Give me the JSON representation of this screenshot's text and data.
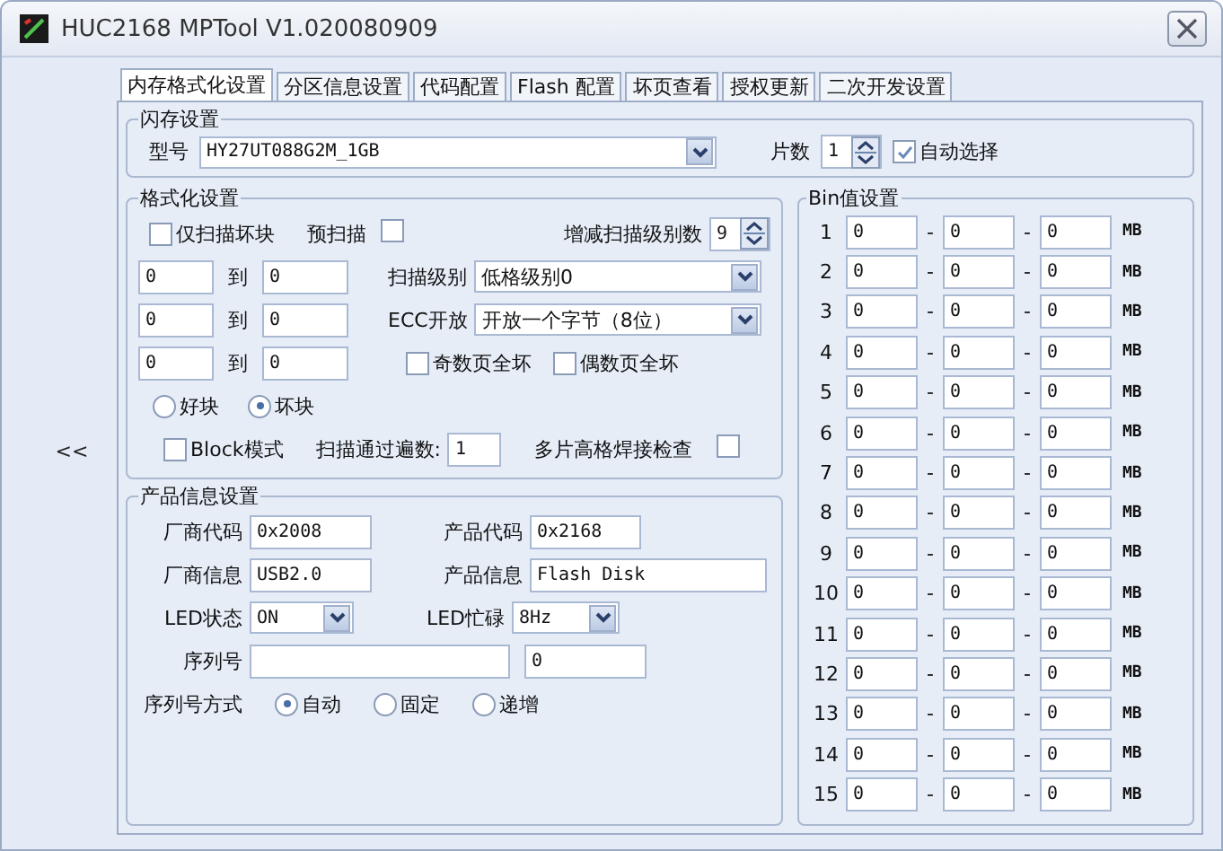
{
  "window": {
    "title": "HUC2168 MPTool V1.020080909"
  },
  "collapse_button": "<<",
  "tabs": [
    {
      "label": "内存格式化设置",
      "selected": true
    },
    {
      "label": "分区信息设置",
      "selected": false
    },
    {
      "label": "代码配置",
      "selected": false
    },
    {
      "label": "Flash 配置",
      "selected": false
    },
    {
      "label": "坏页查看",
      "selected": false
    },
    {
      "label": "授权更新",
      "selected": false
    },
    {
      "label": "二次开发设置",
      "selected": false
    }
  ],
  "flash_group": {
    "title": "闪存设置",
    "model_label": "型号",
    "model_value": "HY27UT088G2M_1GB",
    "chips_label": "片数",
    "chips_value": "1",
    "auto_select": {
      "label": "自动选择",
      "checked": true
    }
  },
  "format_group": {
    "title": "格式化设置",
    "scan_bad_only": {
      "label": "仅扫描坏块",
      "checked": false
    },
    "prescan": {
      "label": "预扫描",
      "checked": false
    },
    "scan_step_label": "增减扫描级别数",
    "scan_step_value": "9",
    "ranges": [
      {
        "from": "0",
        "to_label": "到",
        "to": "0"
      },
      {
        "from": "0",
        "to_label": "到",
        "to": "0"
      },
      {
        "from": "0",
        "to_label": "到",
        "to": "0"
      }
    ],
    "scan_level_label": "扫描级别",
    "scan_level_value": "低格级别0",
    "ecc_label": "ECC开放",
    "ecc_value": "开放一个字节（8位）",
    "odd_pages": {
      "label": "奇数页全坏",
      "checked": false
    },
    "even_pages": {
      "label": "偶数页全坏",
      "checked": false
    },
    "block_type": [
      {
        "label": "好块",
        "selected": false
      },
      {
        "label": "坏块",
        "selected": true
      }
    ],
    "block_mode": {
      "label": "Block模式",
      "checked": false
    },
    "passes_label": "扫描通过遍数:",
    "passes_value": "1",
    "multi_check": {
      "label": "多片高格焊接检查",
      "checked": false
    }
  },
  "product_group": {
    "title": "产品信息设置",
    "vendor_code_label": "厂商代码",
    "vendor_code": "0x2008",
    "product_code_label": "产品代码",
    "product_code": "0x2168",
    "vendor_info_label": "厂商信息",
    "vendor_info": "USB2.0",
    "product_info_label": "产品信息",
    "product_info": "Flash Disk",
    "led_state_label": "LED状态",
    "led_state": "ON",
    "led_busy_label": "LED忙碌",
    "led_busy": "8Hz",
    "serial_label": "序列号",
    "serial_start": "0",
    "serial_mode_label": "序列号方式",
    "serial_modes": [
      {
        "label": "自动",
        "selected": true
      },
      {
        "label": "固定",
        "selected": false
      },
      {
        "label": "递增",
        "selected": false
      }
    ]
  },
  "bin_group": {
    "title": "Bin值设置",
    "rows": [
      {
        "index": "1",
        "value_1": "0",
        "dash_1": "-",
        "value_2": "0",
        "dash_2": "-",
        "value_3": "0",
        "unit": "MB"
      },
      {
        "index": "2",
        "value_1": "0",
        "dash_1": "-",
        "value_2": "0",
        "dash_2": "-",
        "value_3": "0",
        "unit": "MB"
      },
      {
        "index": "3",
        "value_1": "0",
        "dash_1": "-",
        "value_2": "0",
        "dash_2": "-",
        "value_3": "0",
        "unit": "MB"
      },
      {
        "index": "4",
        "value_1": "0",
        "dash_1": "-",
        "value_2": "0",
        "dash_2": "-",
        "value_3": "0",
        "unit": "MB"
      },
      {
        "index": "5",
        "value_1": "0",
        "dash_1": "-",
        "value_2": "0",
        "dash_2": "-",
        "value_3": "0",
        "unit": "MB"
      },
      {
        "index": "6",
        "value_1": "0",
        "dash_1": "-",
        "value_2": "0",
        "dash_2": "-",
        "value_3": "0",
        "unit": "MB"
      },
      {
        "index": "7",
        "value_1": "0",
        "dash_1": "-",
        "value_2": "0",
        "dash_2": "-",
        "value_3": "0",
        "unit": "MB"
      },
      {
        "index": "8",
        "value_1": "0",
        "dash_1": "-",
        "value_2": "0",
        "dash_2": "-",
        "value_3": "0",
        "unit": "MB"
      },
      {
        "index": "9",
        "value_1": "0",
        "dash_1": "-",
        "value_2": "0",
        "dash_2": "-",
        "value_3": "0",
        "unit": "MB"
      },
      {
        "index": "10",
        "value_1": "0",
        "dash_1": "-",
        "value_2": "0",
        "dash_2": "-",
        "value_3": "0",
        "unit": "MB"
      },
      {
        "index": "11",
        "value_1": "0",
        "dash_1": "-",
        "value_2": "0",
        "dash_2": "-",
        "value_3": "0",
        "unit": "MB"
      },
      {
        "index": "12",
        "value_1": "0",
        "dash_1": "-",
        "value_2": "0",
        "dash_2": "-",
        "value_3": "0",
        "unit": "MB"
      },
      {
        "index": "13",
        "value_1": "0",
        "dash_1": "-",
        "value_2": "0",
        "dash_2": "-",
        "value_3": "0",
        "unit": "MB"
      },
      {
        "index": "14",
        "value_1": "0",
        "dash_1": "-",
        "value_2": "0",
        "dash_2": "-",
        "value_3": "0",
        "unit": "MB"
      },
      {
        "index": "15",
        "value_1": "0",
        "dash_1": "-",
        "value_2": "0",
        "dash_2": "-",
        "value_3": "0",
        "unit": "MB"
      }
    ]
  }
}
